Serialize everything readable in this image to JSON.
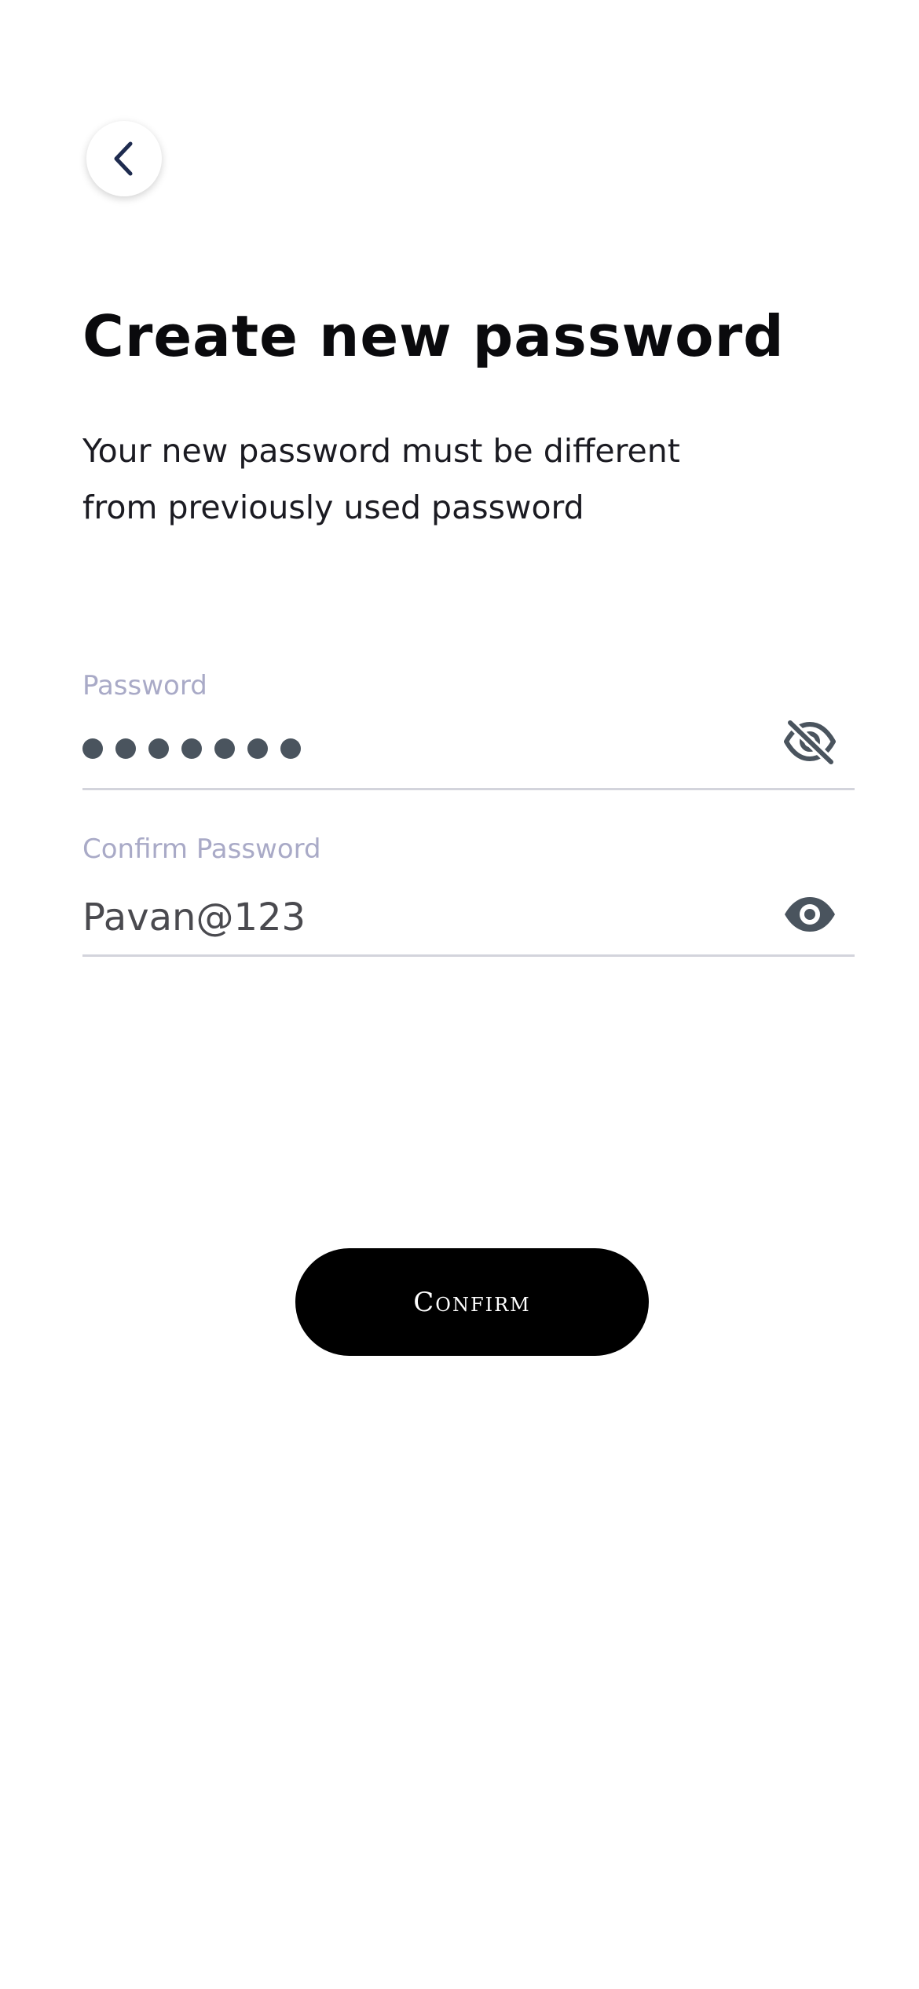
{
  "header": {
    "back_icon": "chevron-left-icon"
  },
  "page": {
    "title": "Create new password",
    "subtitle_line1": "Your new password must be different",
    "subtitle_line2": "from previously used password"
  },
  "form": {
    "password": {
      "label": "Password",
      "masked_length": 7,
      "visibility_icon": "eye-off-icon"
    },
    "confirm_password": {
      "label": "Confirm Password",
      "value": "Pavan@123",
      "visibility_icon": "eye-icon"
    }
  },
  "actions": {
    "confirm_label": "Confirm"
  },
  "colors": {
    "label": "#a9aac7",
    "underline": "#d3d4dc",
    "button_bg": "#000000",
    "button_text": "#ffffff",
    "icon": "#4a545e",
    "back_icon": "#1e2b4f"
  }
}
